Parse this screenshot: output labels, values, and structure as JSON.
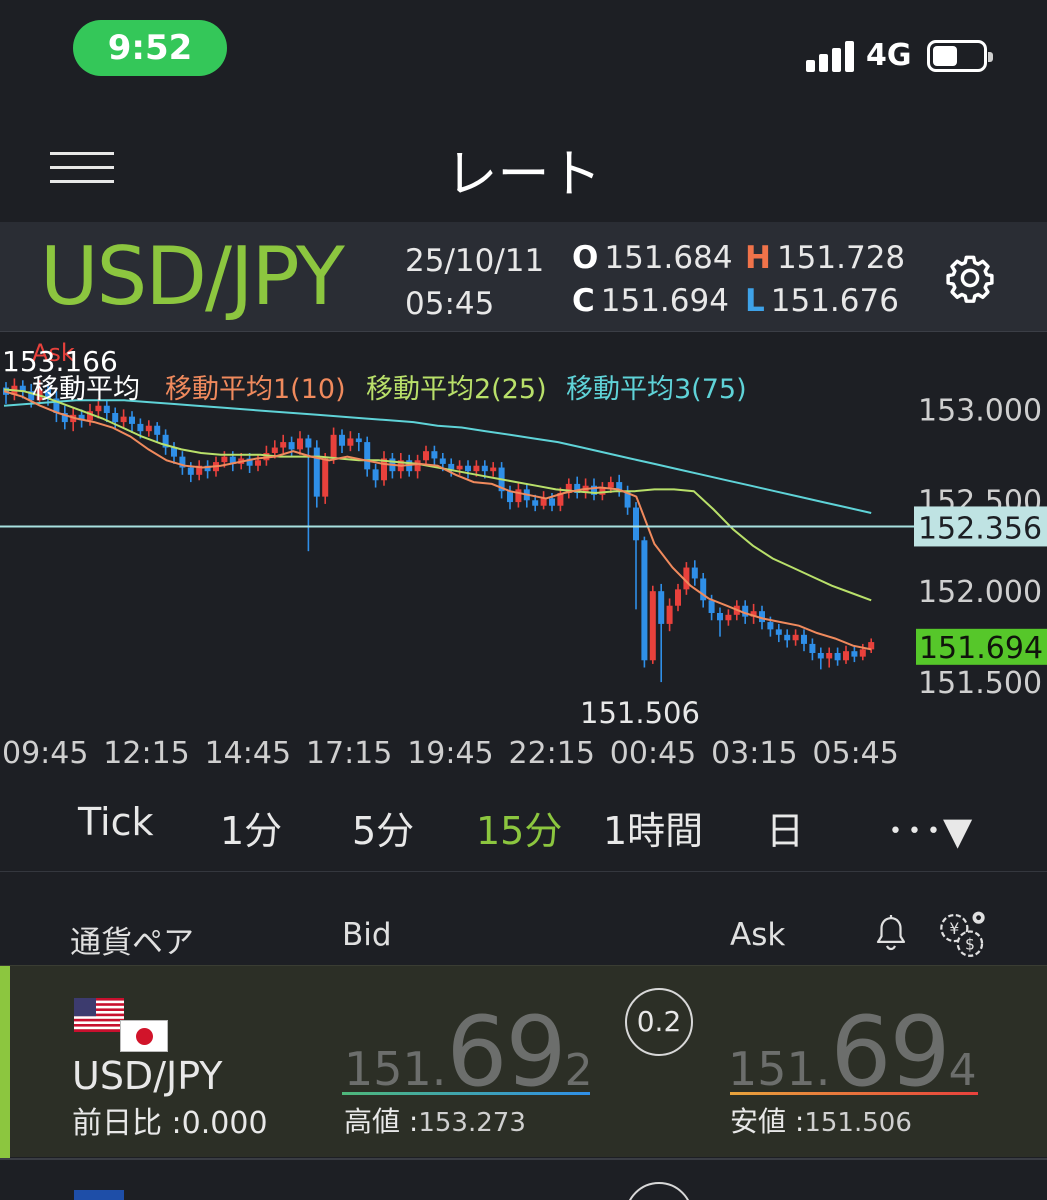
{
  "status_bar": {
    "time": "9:52",
    "network": "4G"
  },
  "header": {
    "title": "レート"
  },
  "symbol_bar": {
    "symbol": "USD/JPY",
    "date": "25/10/11",
    "time": "05:45",
    "open_label": "O",
    "open": "151.684",
    "high_label": "H",
    "high": "151.728",
    "close_label": "C",
    "close": "151.694",
    "low_label": "L",
    "low": "151.676"
  },
  "chart_data": {
    "type": "candlestick",
    "price_side": "Ask",
    "top_left_value": "153.166",
    "legend": [
      {
        "name": "移動平均",
        "color": "#ffffff"
      },
      {
        "name": "移動平均1(10)",
        "color": "#f08a5d"
      },
      {
        "name": "移動平均2(25)",
        "color": "#b9e06a"
      },
      {
        "name": "移動平均3(75)",
        "color": "#5fd3d8"
      }
    ],
    "y_ticks": [
      "153.000",
      "152.500",
      "152.000",
      "151.500"
    ],
    "ylim": [
      151.33,
      153.42
    ],
    "x_ticks": [
      "09:45",
      "12:15",
      "14:45",
      "17:15",
      "19:45",
      "22:15",
      "00:45",
      "03:15",
      "05:45"
    ],
    "min_label": "151.506",
    "reference_line": {
      "value": 152.356,
      "label": "152.356"
    },
    "current_price": {
      "value": 151.694,
      "label": "151.694"
    },
    "colors": {
      "up": "#e8413c",
      "down": "#2f8fe8"
    },
    "candles": [
      [
        153.12,
        153.08,
        153.15,
        153.03
      ],
      [
        153.08,
        153.13,
        153.17,
        153.05
      ],
      [
        153.13,
        153.1,
        153.16,
        153.06
      ],
      [
        153.1,
        153.05,
        153.14,
        153.01
      ],
      [
        153.05,
        153.11,
        153.16,
        153.03
      ],
      [
        153.11,
        153.06,
        153.14,
        153.02
      ],
      [
        153.06,
        152.98,
        153.1,
        152.93
      ],
      [
        152.98,
        152.93,
        153.02,
        152.89
      ],
      [
        152.93,
        152.97,
        153.01,
        152.88
      ],
      [
        152.97,
        152.94,
        153.0,
        152.9
      ],
      [
        152.94,
        152.99,
        153.03,
        152.91
      ],
      [
        152.99,
        153.02,
        153.06,
        152.95
      ],
      [
        153.02,
        152.98,
        153.05,
        152.93
      ],
      [
        152.98,
        152.93,
        153.01,
        152.89
      ],
      [
        152.93,
        152.96,
        153.0,
        152.9
      ],
      [
        152.96,
        152.92,
        152.99,
        152.87
      ],
      [
        152.92,
        152.88,
        152.95,
        152.84
      ],
      [
        152.88,
        152.91,
        152.94,
        152.85
      ],
      [
        152.91,
        152.86,
        152.93,
        152.82
      ],
      [
        152.86,
        152.79,
        152.89,
        152.75
      ],
      [
        152.79,
        152.74,
        152.82,
        152.7
      ],
      [
        152.74,
        152.68,
        152.77,
        152.64
      ],
      [
        152.68,
        152.64,
        152.71,
        152.6
      ],
      [
        152.64,
        152.69,
        152.72,
        152.61
      ],
      [
        152.69,
        152.66,
        152.72,
        152.62
      ],
      [
        152.66,
        152.71,
        152.74,
        152.63
      ],
      [
        152.71,
        152.74,
        152.77,
        152.68
      ],
      [
        152.74,
        152.7,
        152.77,
        152.66
      ],
      [
        152.7,
        152.73,
        152.76,
        152.67
      ],
      [
        152.73,
        152.69,
        152.76,
        152.65
      ],
      [
        152.69,
        152.72,
        152.75,
        152.66
      ],
      [
        152.72,
        152.76,
        152.8,
        152.69
      ],
      [
        152.76,
        152.79,
        152.83,
        152.73
      ],
      [
        152.79,
        152.82,
        152.86,
        152.76
      ],
      [
        152.82,
        152.78,
        152.85,
        152.74
      ],
      [
        152.78,
        152.84,
        152.88,
        152.75
      ],
      [
        152.84,
        152.79,
        152.86,
        152.22
      ],
      [
        152.79,
        152.52,
        152.83,
        152.46
      ],
      [
        152.52,
        152.73,
        152.76,
        152.48
      ],
      [
        152.73,
        152.86,
        152.9,
        152.7
      ],
      [
        152.86,
        152.8,
        152.89,
        152.76
      ],
      [
        152.8,
        152.84,
        152.88,
        152.77
      ],
      [
        152.84,
        152.82,
        152.87,
        152.77
      ],
      [
        152.82,
        152.67,
        152.85,
        152.63
      ],
      [
        152.67,
        152.61,
        152.7,
        152.57
      ],
      [
        152.61,
        152.73,
        152.77,
        152.58
      ],
      [
        152.73,
        152.66,
        152.76,
        152.62
      ],
      [
        152.66,
        152.72,
        152.76,
        152.62
      ],
      [
        152.72,
        152.66,
        152.75,
        152.63
      ],
      [
        152.66,
        152.72,
        152.75,
        152.62
      ],
      [
        152.72,
        152.77,
        152.8,
        152.69
      ],
      [
        152.77,
        152.73,
        152.8,
        152.69
      ],
      [
        152.73,
        152.7,
        152.76,
        152.66
      ],
      [
        152.7,
        152.67,
        152.73,
        152.63
      ],
      [
        152.67,
        152.69,
        152.72,
        152.64
      ],
      [
        152.69,
        152.66,
        152.72,
        152.62
      ],
      [
        152.66,
        152.69,
        152.72,
        152.63
      ],
      [
        152.69,
        152.66,
        152.72,
        152.62
      ],
      [
        152.66,
        152.68,
        152.71,
        152.63
      ],
      [
        152.68,
        152.55,
        152.71,
        152.51
      ],
      [
        152.55,
        152.49,
        152.58,
        152.45
      ],
      [
        152.49,
        152.56,
        152.6,
        152.46
      ],
      [
        152.56,
        152.5,
        152.59,
        152.46
      ],
      [
        152.5,
        152.47,
        152.53,
        152.44
      ],
      [
        152.47,
        152.51,
        152.55,
        152.45
      ],
      [
        152.51,
        152.47,
        152.54,
        152.44
      ],
      [
        152.47,
        152.54,
        152.57,
        152.44
      ],
      [
        152.54,
        152.59,
        152.62,
        152.51
      ],
      [
        152.59,
        152.54,
        152.63,
        152.51
      ],
      [
        152.54,
        152.58,
        152.62,
        152.51
      ],
      [
        152.58,
        152.53,
        152.62,
        152.5
      ],
      [
        152.53,
        152.57,
        152.6,
        152.5
      ],
      [
        152.57,
        152.6,
        152.63,
        152.54
      ],
      [
        152.6,
        152.55,
        152.64,
        152.52
      ],
      [
        152.55,
        152.46,
        152.58,
        152.42
      ],
      [
        152.46,
        152.28,
        152.49,
        151.9
      ],
      [
        152.28,
        151.62,
        152.3,
        151.58
      ],
      [
        151.62,
        152.0,
        152.03,
        151.6
      ],
      [
        152.0,
        151.82,
        152.04,
        151.5
      ],
      [
        151.82,
        151.92,
        151.96,
        151.78
      ],
      [
        151.92,
        152.01,
        152.04,
        151.89
      ],
      [
        152.01,
        152.13,
        152.16,
        151.98
      ],
      [
        152.13,
        152.07,
        152.17,
        152.03
      ],
      [
        152.07,
        151.95,
        152.1,
        151.91
      ],
      [
        151.95,
        151.88,
        151.98,
        151.84
      ],
      [
        151.88,
        151.84,
        151.91,
        151.75
      ],
      [
        151.84,
        151.87,
        151.9,
        151.81
      ],
      [
        151.87,
        151.92,
        151.95,
        151.84
      ],
      [
        151.92,
        151.86,
        151.95,
        151.82
      ],
      [
        151.86,
        151.89,
        151.93,
        151.82
      ],
      [
        151.89,
        151.83,
        151.92,
        151.79
      ],
      [
        151.83,
        151.79,
        151.86,
        151.75
      ],
      [
        151.79,
        151.76,
        151.82,
        151.72
      ],
      [
        151.76,
        151.73,
        151.79,
        151.69
      ],
      [
        151.73,
        151.76,
        151.79,
        151.7
      ],
      [
        151.76,
        151.71,
        151.79,
        151.67
      ],
      [
        151.71,
        151.66,
        151.74,
        151.62
      ],
      [
        151.66,
        151.63,
        151.69,
        151.57
      ],
      [
        151.63,
        151.66,
        151.69,
        151.58
      ],
      [
        151.66,
        151.62,
        151.69,
        151.59
      ],
      [
        151.62,
        151.67,
        151.7,
        151.6
      ],
      [
        151.67,
        151.64,
        151.7,
        151.61
      ],
      [
        151.64,
        151.68,
        151.71,
        151.62
      ],
      [
        151.68,
        151.72,
        151.74,
        151.66
      ]
    ],
    "ma1": [
      153.1,
      153.07,
      153.02,
      152.98,
      152.95,
      152.93,
      152.9,
      152.85,
      152.78,
      152.72,
      152.69,
      152.68,
      152.69,
      152.71,
      152.73,
      152.74,
      152.77,
      152.74,
      152.72,
      152.74,
      152.72,
      152.7,
      152.69,
      152.7,
      152.69,
      152.64,
      152.6,
      152.59,
      152.55,
      152.53,
      152.51,
      152.54,
      152.56,
      152.57,
      152.56,
      152.52,
      152.26,
      152.13,
      152.03,
      151.96,
      151.92,
      151.88,
      151.85,
      151.83,
      151.81,
      151.77,
      151.74,
      151.7,
      151.68
    ],
    "ma2": [
      153.11,
      153.1,
      153.07,
      153.03,
      152.99,
      152.95,
      152.9,
      152.85,
      152.81,
      152.78,
      152.76,
      152.75,
      152.75,
      152.75,
      152.74,
      152.74,
      152.74,
      152.73,
      152.72,
      152.72,
      152.71,
      152.7,
      152.68,
      152.66,
      152.64,
      152.62,
      152.6,
      152.58,
      152.56,
      152.55,
      152.54,
      152.55,
      152.55,
      152.56,
      152.56,
      152.55,
      152.45,
      152.34,
      152.25,
      152.18,
      152.13,
      152.08,
      152.03,
      151.99,
      151.95
    ],
    "ma3": [
      153.02,
      153.03,
      153.04,
      153.05,
      153.05,
      153.05,
      153.04,
      153.03,
      153.02,
      153.01,
      153.0,
      152.99,
      152.98,
      152.97,
      152.96,
      152.95,
      152.94,
      152.93,
      152.91,
      152.9,
      152.88,
      152.86,
      152.84,
      152.82,
      152.79,
      152.76,
      152.73,
      152.7,
      152.67,
      152.64,
      152.61,
      152.58,
      152.55,
      152.52,
      152.49,
      152.46,
      152.43
    ]
  },
  "timeframes": [
    {
      "label": "Tick",
      "active": false
    },
    {
      "label": "1分",
      "active": false
    },
    {
      "label": "5分",
      "active": false
    },
    {
      "label": "15分",
      "active": true
    },
    {
      "label": "1時間",
      "active": false
    },
    {
      "label": "日",
      "active": false
    },
    {
      "label": "･･･▼",
      "active": false
    }
  ],
  "list_header": {
    "pair": "通貨ペア",
    "bid": "Bid",
    "ask": "Ask"
  },
  "icons": {
    "bell": "bell-icon",
    "settings": "currency-settings-icon",
    "menu": "hamburger-icon",
    "gear": "gear-icon"
  },
  "rows": [
    {
      "pair": "USD/JPY",
      "change_label": "前日比 :",
      "change": "0.000",
      "spread": "0.2",
      "bid": {
        "p1": "151.",
        "p2": "69",
        "p3": "2"
      },
      "ask": {
        "p1": "151.",
        "p2": "69",
        "p3": "4"
      },
      "high_label": "高値 :",
      "high": "153.273",
      "low_label": "安値 :",
      "low": "151.506"
    }
  ]
}
